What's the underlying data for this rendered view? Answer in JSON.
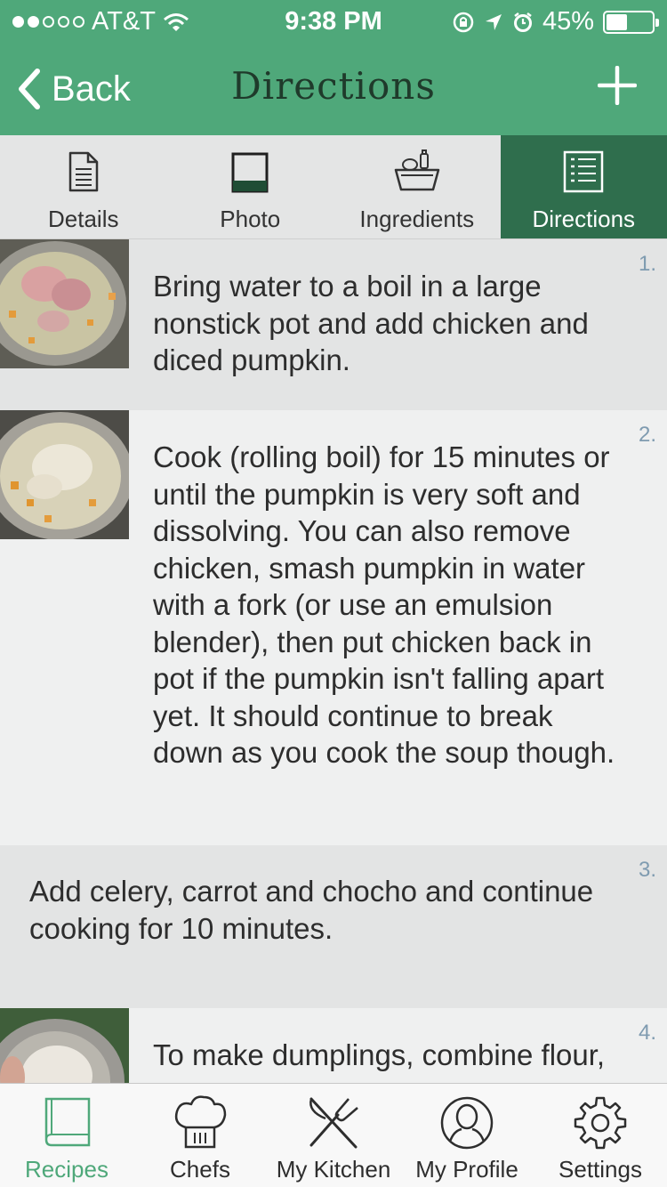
{
  "status": {
    "carrier": "AT&T",
    "signal_dots": 5,
    "signal_filled": 2,
    "time": "9:38 PM",
    "battery": "45%",
    "battery_level": 0.45
  },
  "nav": {
    "back_label": "Back",
    "title": "Directions"
  },
  "tabs": [
    {
      "label": "Details",
      "icon": "document-icon"
    },
    {
      "label": "Photo",
      "icon": "photo-icon"
    },
    {
      "label": "Ingredients",
      "icon": "basket-icon"
    },
    {
      "label": "Directions",
      "icon": "list-icon",
      "active": true
    }
  ],
  "steps": [
    {
      "number": "1.",
      "has_photo": true,
      "text": "Bring water to a boil in a large nonstick pot and add chicken and diced pumpkin."
    },
    {
      "number": "2.",
      "has_photo": true,
      "text": "Cook (rolling boil) for 15 minutes or until the pumpkin is very soft and dissolving. You can also remove chicken, smash pumpkin in water with a fork (or use an emulsion blender), then put chicken back in pot if the pumpkin isn't falling apart yet. It should continue to break down as you cook the soup though."
    },
    {
      "number": "3.",
      "has_photo": false,
      "text": "Add celery, carrot and chocho and continue cooking for 10 minutes."
    },
    {
      "number": "4.",
      "has_photo": true,
      "text": "To make dumplings, combine flour,"
    }
  ],
  "tab_bar": [
    {
      "label": "Recipes",
      "icon": "book-icon",
      "active": true
    },
    {
      "label": "Chefs",
      "icon": "chef-hat-icon"
    },
    {
      "label": "My Kitchen",
      "icon": "fork-knife-icon"
    },
    {
      "label": "My Profile",
      "icon": "profile-icon"
    },
    {
      "label": "Settings",
      "icon": "gear-icon"
    }
  ],
  "colors": {
    "brand_green": "#4fa87a",
    "active_tab": "#2f6e4d",
    "step_number": "#7f9bb0"
  }
}
